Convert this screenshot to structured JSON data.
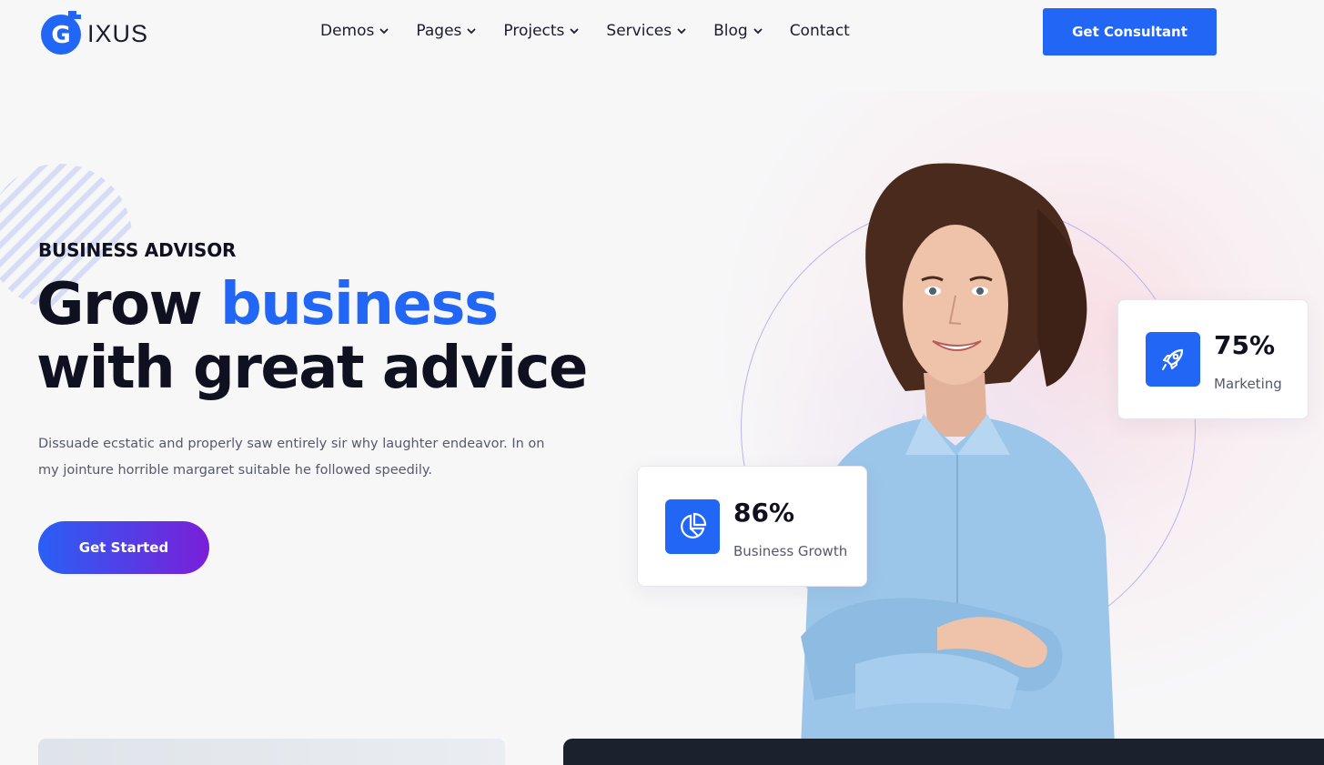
{
  "brand": {
    "logo_letter": "G",
    "logo_text": "IXUS",
    "primary_color": "#2266f5",
    "icon": "g-logo-icon"
  },
  "nav": {
    "items": [
      {
        "label": "Demos",
        "has_dropdown": true
      },
      {
        "label": "Pages",
        "has_dropdown": true
      },
      {
        "label": "Projects",
        "has_dropdown": true
      },
      {
        "label": "Services",
        "has_dropdown": true
      },
      {
        "label": "Blog",
        "has_dropdown": true
      },
      {
        "label": "Contact",
        "has_dropdown": false
      }
    ],
    "cta_label": "Get Consultant"
  },
  "hero": {
    "eyebrow": "BUSINESS ADVISOR",
    "headline_part1": "Grow ",
    "headline_accent": "business",
    "headline_part2": "with great advice",
    "description": "Dissuade ecstatic and properly saw entirely sir why laughter endeavor. In on my jointure horrible margaret suitable he followed speedily.",
    "cta_label": "Get Started",
    "cta_gradient": [
      "#2a5ff5",
      "#7a1fd8"
    ]
  },
  "stats": [
    {
      "value": "86%",
      "label": "Business Growth",
      "icon": "pie-chart-icon"
    },
    {
      "value": "75%",
      "label": "Marketing",
      "icon": "rocket-icon"
    }
  ]
}
